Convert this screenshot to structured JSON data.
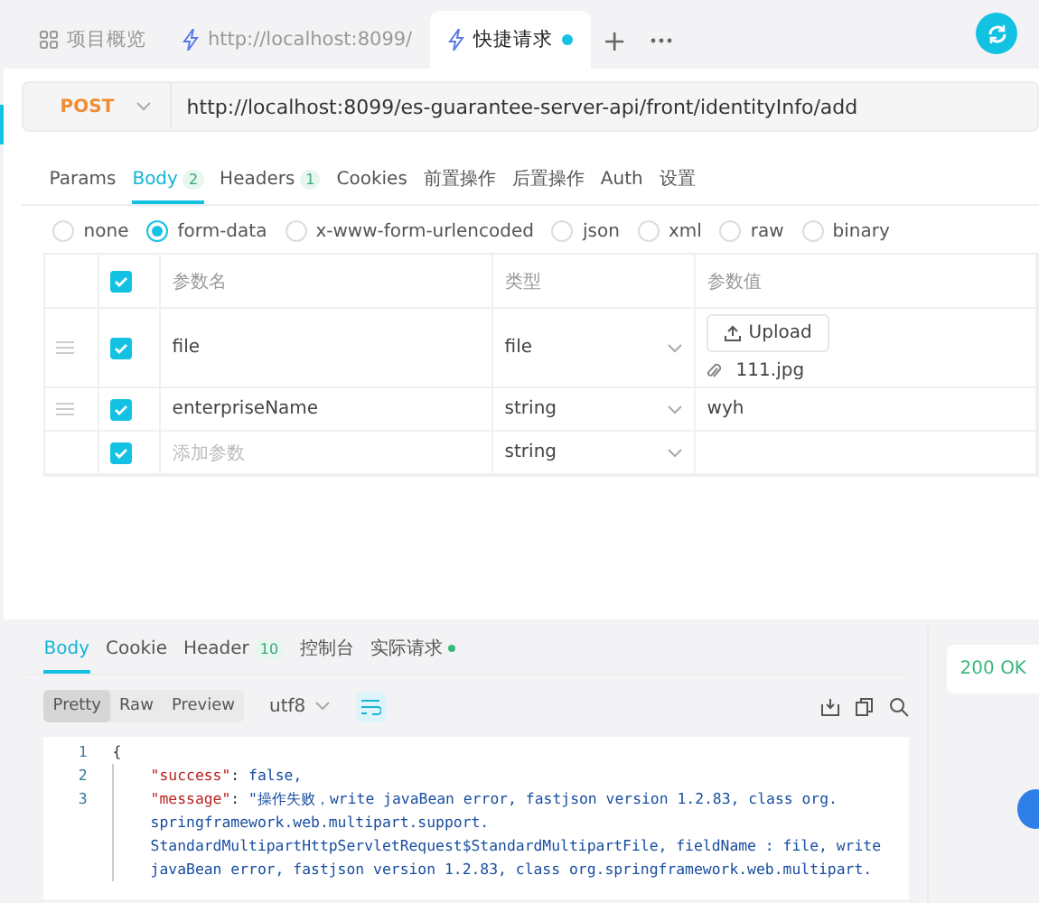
{
  "new_tab": "+",
  "tabs": [
    {
      "kind": "overview",
      "label": "项目概览",
      "selected": false,
      "dot": false
    },
    {
      "kind": "request",
      "label": "http://localhost:8099/",
      "selected": false,
      "dot": false
    },
    {
      "kind": "request",
      "label": "快捷请求",
      "selected": true,
      "dot": true
    }
  ],
  "request": {
    "method": "POST",
    "url": "http://localhost:8099/es-guarantee-server-api/front/identityInfo/add"
  },
  "request_tabs": [
    {
      "label": "Params",
      "selected": false
    },
    {
      "label": "Body",
      "badge": "2",
      "selected": true
    },
    {
      "label": "Headers",
      "badge": "1",
      "selected": false
    },
    {
      "label": "Cookies",
      "selected": false
    },
    {
      "label": "前置操作",
      "selected": false
    },
    {
      "label": "后置操作",
      "selected": false
    },
    {
      "label": "Auth",
      "selected": false
    },
    {
      "label": "设置",
      "selected": false
    }
  ],
  "body_types": [
    {
      "label": "none",
      "selected": false
    },
    {
      "label": "form-data",
      "selected": true
    },
    {
      "label": "x-www-form-urlencoded",
      "selected": false
    },
    {
      "label": "json",
      "selected": false
    },
    {
      "label": "xml",
      "selected": false
    },
    {
      "label": "raw",
      "selected": false
    },
    {
      "label": "binary",
      "selected": false
    }
  ],
  "table": {
    "header_checked": true,
    "columns": [
      "参数名",
      "类型",
      "参数值"
    ],
    "rows": [
      {
        "kind": "file",
        "checked": true,
        "name": "file",
        "type": "file",
        "upload": "Upload",
        "value": "111.jpg"
      },
      {
        "kind": "text",
        "checked": true,
        "name": "enterpriseName",
        "type": "string",
        "value": "wyh"
      },
      {
        "kind": "new",
        "checked": true,
        "placeholder": "添加参数",
        "type": "string"
      }
    ]
  },
  "response_tabs": [
    {
      "label": "Body",
      "dot": false,
      "selected": true
    },
    {
      "label": "Cookie",
      "dot": false,
      "selected": false
    },
    {
      "label": "Header",
      "badge": "10",
      "dot": false,
      "selected": false
    },
    {
      "label": "控制台",
      "dot": false,
      "selected": false
    },
    {
      "label": "实际请求",
      "dot": true,
      "selected": false
    }
  ],
  "view_modes": [
    {
      "label": "Pretty",
      "selected": true
    },
    {
      "label": "Raw",
      "selected": false
    },
    {
      "label": "Preview",
      "selected": false
    }
  ],
  "encoding": "utf8",
  "code": [
    {
      "number": "1",
      "kind": "plain",
      "text": "{"
    },
    {
      "number": "2",
      "kind": "pair",
      "key": "\"success\"",
      "colon": ":",
      "value": "false,"
    },
    {
      "number": "3",
      "kind": "pair",
      "key": "\"message\"",
      "colon": ":",
      "value": "\"操作失败，write javaBean error, fastjson version 1.2.83, class org.",
      "wrapped": [
        "springframework.web.multipart.support.",
        "StandardMultipartHttpServletRequest$StandardMultipartFile, fieldName : file, write",
        "javaBean error, fastjson version 1.2.83, class org.springframework.web.multipart."
      ]
    }
  ],
  "status": "200 OK"
}
